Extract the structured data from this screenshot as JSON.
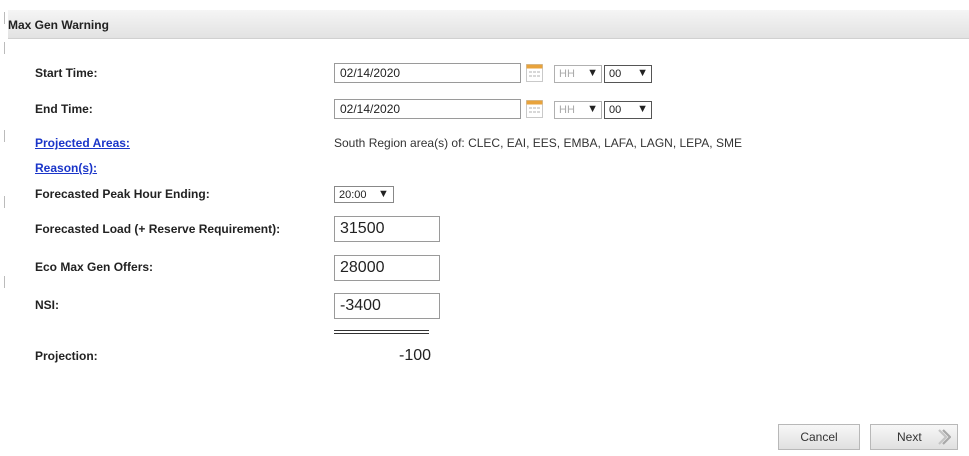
{
  "header": {
    "title": "Max Gen Warning"
  },
  "form": {
    "start_time": {
      "label": "Start Time:",
      "date": "02/14/2020",
      "hour_placeholder": "HH",
      "minute": "00"
    },
    "end_time": {
      "label": "End Time:",
      "date": "02/14/2020",
      "hour_placeholder": "HH",
      "minute": "00"
    },
    "projected_areas": {
      "label": "Projected Areas:",
      "value": "South Region area(s) of: CLEC, EAI, EES, EMBA, LAFA, LAGN, LEPA, SME"
    },
    "reasons": {
      "label": "Reason(s):"
    },
    "peak_hour": {
      "label": "Forecasted Peak Hour Ending:",
      "value": "20:00"
    },
    "forecasted_load": {
      "label": "Forecasted Load (+ Reserve Requirement):",
      "value": "31500"
    },
    "eco_max": {
      "label": "Eco Max Gen Offers:",
      "value": "28000"
    },
    "nsi": {
      "label": "NSI:",
      "value": "-3400"
    },
    "projection": {
      "label": "Projection:",
      "value": "-100"
    }
  },
  "buttons": {
    "cancel": "Cancel",
    "next": "Next"
  },
  "icons": {
    "calendar": "calendar-icon",
    "dropdown": "dropdown-arrow-icon",
    "next": "chevron-right-icon"
  },
  "colors": {
    "link": "#1a35c9",
    "calendar": "#e8a33c"
  }
}
